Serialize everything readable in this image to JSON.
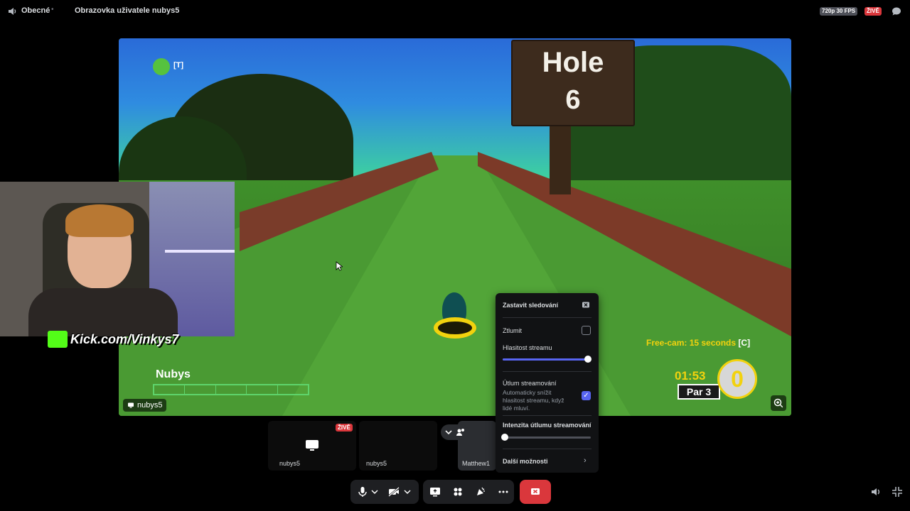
{
  "topbar": {
    "channel_icon": "speaker-icon",
    "channel_name": "Obecné",
    "separator": "•",
    "screen_title": "Obrazovka uživatele nubys5",
    "quality": "720p 30 FPS",
    "live": "ŽIVĚ",
    "chat_icon": "chat-bubble-icon"
  },
  "stream": {
    "chat_hint_key": "[T]",
    "sign_word": "Hole",
    "sign_number": "6",
    "player_name": "Nubys",
    "freecam_text": "Free-cam: 15 seconds",
    "freecam_key": "[C]",
    "timer": "01:53",
    "par": "Par 3",
    "strokes": "0",
    "owner": "nubys5",
    "zoom_icon": "zoom-in-icon"
  },
  "webcam": {
    "overlay_text": "Kick.com/Vinkys7"
  },
  "tiles": {
    "tile1_owner": "nubys5",
    "tile1_live": "ŽIVĚ",
    "tile2_owner": "nubys5",
    "tile3_owner": "Matthew1"
  },
  "popup": {
    "stop_watching": "Zastavit sledování",
    "mute": "Ztlumit",
    "mute_checked": false,
    "stream_volume_label": "Hlasitost streamu",
    "stream_volume": 1.0,
    "ducking_label": "Útlum streamování",
    "ducking_desc": "Automaticky snížit hlasitost streamu, když lidé mluví.",
    "ducking_checked": true,
    "ducking_intensity_label": "Intenzita útlumu streamování",
    "ducking_intensity": 0.0,
    "more_options": "Další možnosti"
  },
  "controls": {
    "mic_icon": "microphone-icon",
    "camera_icon": "camera-off-icon",
    "share_icon": "screen-share-icon",
    "activities_icon": "activities-icon",
    "soundboard_icon": "soundboard-icon",
    "more_icon": "more-icon",
    "leave_icon": "leave-call-icon"
  },
  "colors": {
    "accent": "#5865f2",
    "danger": "#da373c",
    "popup_bg": "#111214",
    "hud_yellow": "#f2d20e"
  }
}
